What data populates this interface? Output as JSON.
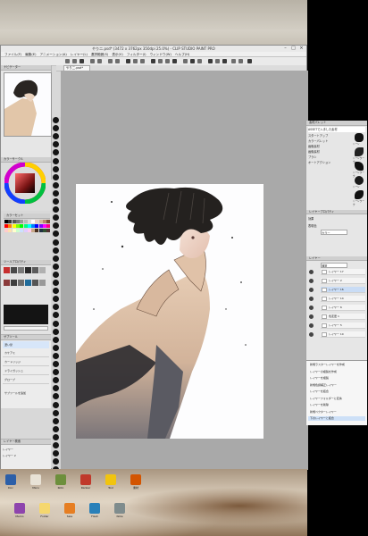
{
  "window": {
    "title": "やり二.psd* (3472 x 3762px 350dpi 25.0%) - CLIP STUDIO PAINT PRO"
  },
  "menubar": {
    "items": [
      "ファイル(F)",
      "編集(E)",
      "アニメーション(A)",
      "レイヤー(L)",
      "選択範囲(S)",
      "表示(V)",
      "フィルター(I)",
      "ウィンドウ(W)",
      "ヘルプ(H)"
    ]
  },
  "tabs": {
    "active": "やり二.psd*"
  },
  "panels": {
    "navigator": "ナビゲーター",
    "color_wheel": "カラーサークル",
    "color_set": "カラーセット",
    "tool_property": "ツールプロパティ",
    "subtool": "サブツール",
    "subtool_selected": "濃い髪",
    "subtool_button": "サブツールを追加",
    "layer_search": "レイヤー検索"
  },
  "right_panel": {
    "material_title": "素材パレット",
    "material_tag": "ASSETで入手した素材",
    "tree": [
      "スタートアップ",
      "カラーパレット",
      "画像素材",
      "画像素材",
      "ブラシ",
      "オートアクション"
    ],
    "layer_property": "レイヤープロパティ",
    "effect": "効果",
    "blend_label": "表現色",
    "blend_value": "カラー",
    "layer_panel": "レイヤー",
    "blend_mode": "通常",
    "layers": [
      {
        "name": "100 % 通常",
        "sub": "レイヤー 17"
      },
      {
        "name": "100 % 通常",
        "sub": "レイヤー 2"
      },
      {
        "name": "100 % 通常",
        "sub": "レイヤー 16"
      },
      {
        "name": "100 % 通常",
        "sub": "レイヤー 14"
      },
      {
        "name": "100 % 通常",
        "sub": "レイヤー 6"
      },
      {
        "name": "86 % オーバーレイ",
        "sub": "色変更 1"
      },
      {
        "name": "100 % 通常",
        "sub": "レイヤー 5"
      },
      {
        "name": "100 % 通常",
        "sub": "レイヤー 10"
      }
    ],
    "context_menu": [
      "新規ラスターレイヤーを作成",
      "レイヤーの複製を作成",
      "レイヤーを複製",
      "新規色調補正レイヤー",
      "レイヤーを結合",
      "レイヤーフォルダーに変換",
      "レイヤーを削除",
      "新規ベクターレイヤー",
      "下のレイヤーと結合"
    ],
    "thumb_labels": [
      "トーン",
      "トーンワーク",
      "トーンワーク",
      "トーン",
      "トーンワーク"
    ]
  },
  "subtools": [
    "濃い髪",
    "カケアミ",
    "カートリッジ",
    "ドライガッシュ",
    "グローブ"
  ],
  "layer_mini": [
    "レイヤー",
    "レイヤー 2"
  ],
  "desktop": {
    "icons": [
      "Doc",
      "Maru",
      "Roto",
      "Ranker",
      "Tool",
      "素材",
      "Memo",
      "Folder",
      "Sale",
      "Flash",
      "Note"
    ]
  },
  "colors": {
    "window_bg": "#d8d8d8",
    "canvas_bg": "#a9a9a9",
    "selection": "#c9dcf5"
  }
}
